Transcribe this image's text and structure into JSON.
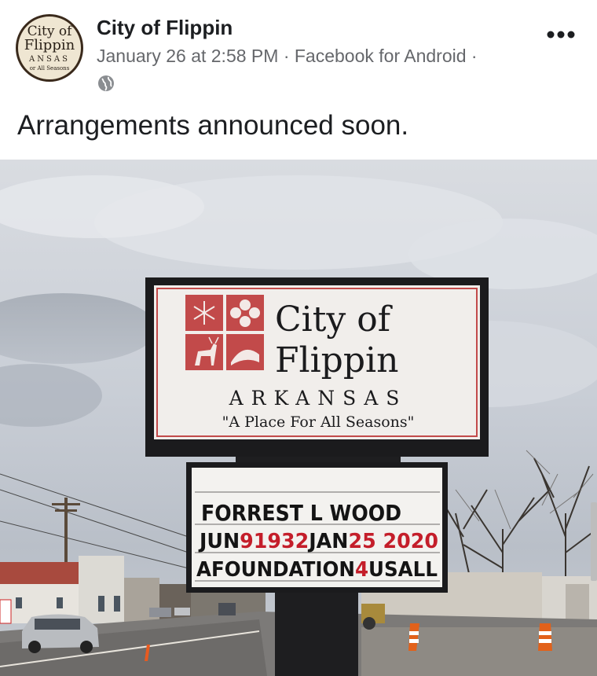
{
  "post": {
    "page_name": "City of Flippin",
    "timestamp": "January 26 at 2:58 PM",
    "separator": "·",
    "source": "Facebook for Android",
    "trailing_separator": "·",
    "caption": "Arrangements announced soon.",
    "privacy_icon": "globe-icon",
    "menu_icon": "more-options-icon"
  },
  "avatar": {
    "line1": "City of",
    "line2": "Flippin",
    "line3": "ANSAS",
    "line4": "or All Seasons"
  },
  "sign": {
    "title_line1": "City of",
    "title_line2": "Flippin",
    "state": "ARKANSAS",
    "slogan": "\"A Place For All Seasons\"",
    "marquee": [
      [
        {
          "text": "FORREST L WOOD",
          "color": "black"
        }
      ],
      [
        {
          "text": "JUN",
          "color": "black"
        },
        {
          "text": "9",
          "color": "red"
        },
        {
          "text": "1932",
          "color": "red"
        },
        {
          "text": "JAN",
          "color": "black"
        },
        {
          "text": "25",
          "color": "red"
        },
        {
          "text": " 2020",
          "color": "red"
        }
      ],
      [
        {
          "text": "AFOUNDATION",
          "color": "black"
        },
        {
          "text": "4",
          "color": "red"
        },
        {
          "text": "USALL",
          "color": "black"
        }
      ]
    ]
  },
  "colors": {
    "name": "#1c1e21",
    "meta": "#65676b",
    "sign_red": "#c24a4a",
    "marquee_red": "#c41e2a"
  }
}
